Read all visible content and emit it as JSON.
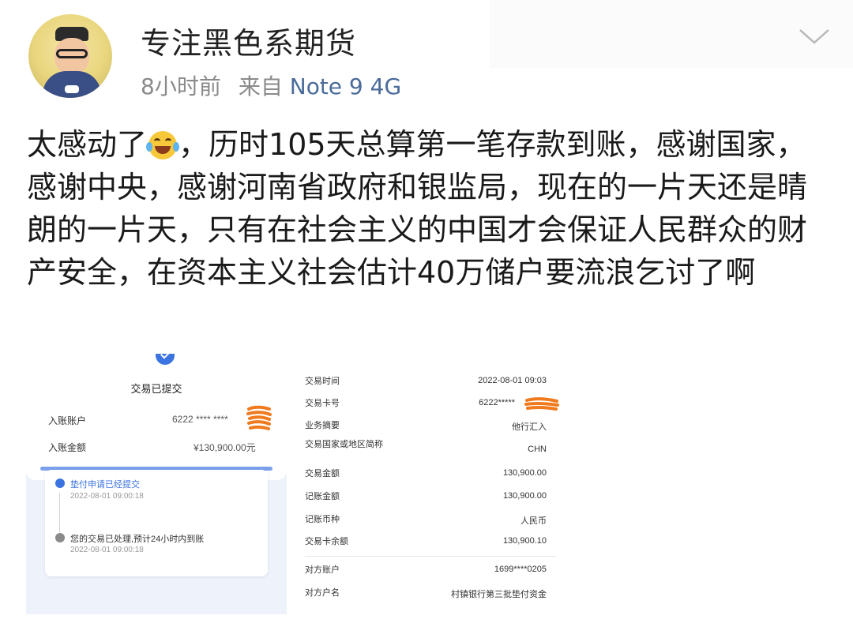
{
  "post_header": {
    "username": "专注黑色系期货",
    "time": "8小时前",
    "source_prefix": "来自",
    "source": "Note 9 4G"
  },
  "post": {
    "text_before_emoji": "太感动了",
    "emoji": "face-with-tears-of-joy-icon",
    "text_after_emoji": "，历时105天总算第一笔存款到账，感谢国家，感谢中央，感谢河南省政府和银监局，现在的一片天还是晴朗的一片天，只有在社会主义的中国才会保证人民群众的财产安全，在资本主义社会估计40万储户要流浪乞讨了啊"
  },
  "image_left": {
    "title": "交易已提交",
    "account_label": "入账账户",
    "account_value": "6222 **** ****",
    "amount_label": "入账金额",
    "amount_value": "¥130,900.00元",
    "steps": [
      {
        "text": "垫付申请已经提交",
        "time": "2022-08-01 09:00:18"
      },
      {
        "text": "您的交易已处理,预计24小时内到账",
        "time": "2022-08-01 09:00:18"
      }
    ]
  },
  "image_right": {
    "rows": [
      {
        "key": "交易时间",
        "value": "2022-08-01 09:03"
      },
      {
        "key": "交易卡号",
        "value": "6222*****"
      },
      {
        "key": "业务摘要",
        "value": "他行汇入"
      },
      {
        "key": "交易国家或地区简称",
        "value": "CHN"
      },
      {
        "key": "交易金额",
        "value": "130,900.00"
      },
      {
        "key": "记账金额",
        "value": "130,900.00"
      },
      {
        "key": "记账币种",
        "value": "人民币"
      },
      {
        "key": "交易卡余额",
        "value": "130,900.10"
      },
      {
        "key": "对方账户",
        "value": "1699****0205"
      },
      {
        "key": "对方户名",
        "value": "村镇银行第三批垫付资金"
      }
    ]
  },
  "colors": {
    "source_link": "#4a6b9a",
    "meta_gray": "#8a8a8a",
    "accent_blue": "#3b73e0",
    "scribble_orange": "#f07a1e"
  }
}
